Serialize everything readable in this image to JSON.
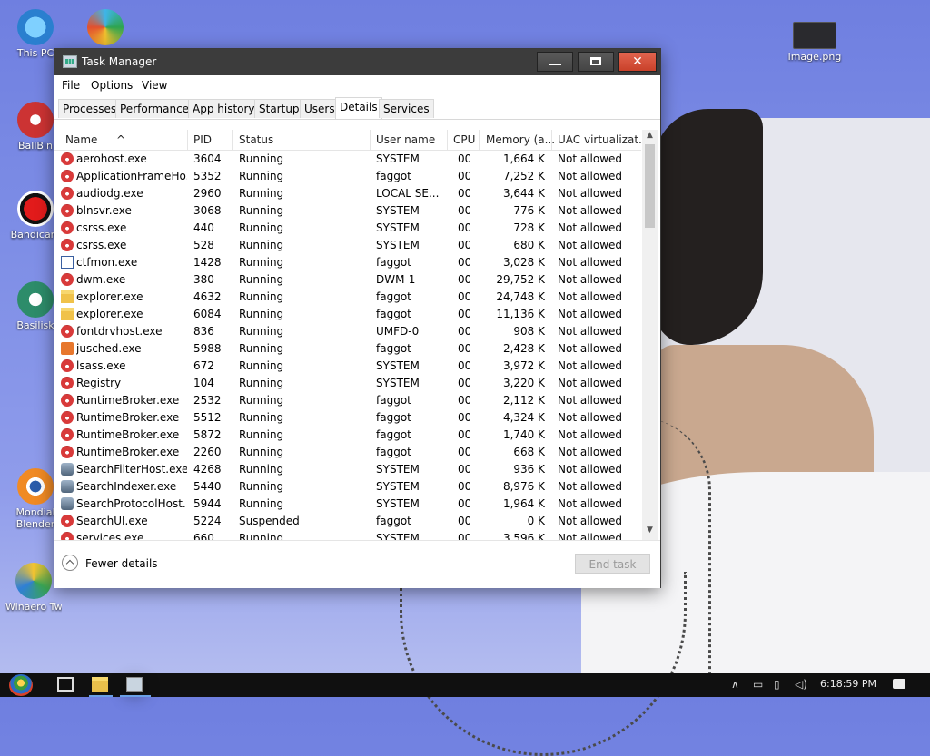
{
  "desktop": {
    "icons": [
      {
        "label": "This PC"
      },
      {
        "label": ""
      },
      {
        "label": "BallBin"
      },
      {
        "label": "Bandicam"
      },
      {
        "label": "Basilisk"
      },
      {
        "label": "Mondial Blender"
      },
      {
        "label": "Winaero Tw..."
      },
      {
        "label": "image.png"
      }
    ]
  },
  "window": {
    "title": "Task Manager",
    "menu": [
      "File",
      "Options",
      "View"
    ],
    "tabs": [
      "Processes",
      "Performance",
      "App history",
      "Startup",
      "Users",
      "Details",
      "Services"
    ],
    "active_tab": "Details",
    "columns": [
      "Name",
      "PID",
      "Status",
      "User name",
      "CPU",
      "Memory (a...",
      "UAC virtualizat..."
    ],
    "rows": [
      {
        "name": "aerohost.exe",
        "pid": "3604",
        "status": "Running",
        "user": "SYSTEM",
        "cpu": "00",
        "mem": "1,664 K",
        "uac": "Not allowed",
        "icon": "generic-process-icon"
      },
      {
        "name": "ApplicationFrameHo...",
        "pid": "5352",
        "status": "Running",
        "user": "faggot",
        "cpu": "00",
        "mem": "7,252 K",
        "uac": "Not allowed",
        "icon": "generic-process-icon"
      },
      {
        "name": "audiodg.exe",
        "pid": "2960",
        "status": "Running",
        "user": "LOCAL SE...",
        "cpu": "00",
        "mem": "3,644 K",
        "uac": "Not allowed",
        "icon": "generic-process-icon"
      },
      {
        "name": "blnsvr.exe",
        "pid": "3068",
        "status": "Running",
        "user": "SYSTEM",
        "cpu": "00",
        "mem": "776 K",
        "uac": "Not allowed",
        "icon": "generic-process-icon"
      },
      {
        "name": "csrss.exe",
        "pid": "440",
        "status": "Running",
        "user": "SYSTEM",
        "cpu": "00",
        "mem": "728 K",
        "uac": "Not allowed",
        "icon": "generic-process-icon"
      },
      {
        "name": "csrss.exe",
        "pid": "528",
        "status": "Running",
        "user": "SYSTEM",
        "cpu": "00",
        "mem": "680 K",
        "uac": "Not allowed",
        "icon": "generic-process-icon"
      },
      {
        "name": "ctfmon.exe",
        "pid": "1428",
        "status": "Running",
        "user": "faggot",
        "cpu": "00",
        "mem": "3,028 K",
        "uac": "Not allowed",
        "icon": "ctfmon-icon"
      },
      {
        "name": "dwm.exe",
        "pid": "380",
        "status": "Running",
        "user": "DWM-1",
        "cpu": "00",
        "mem": "29,752 K",
        "uac": "Not allowed",
        "icon": "generic-process-icon"
      },
      {
        "name": "explorer.exe",
        "pid": "4632",
        "status": "Running",
        "user": "faggot",
        "cpu": "00",
        "mem": "24,748 K",
        "uac": "Not allowed",
        "icon": "folder-icon"
      },
      {
        "name": "explorer.exe",
        "pid": "6084",
        "status": "Running",
        "user": "faggot",
        "cpu": "00",
        "mem": "11,136 K",
        "uac": "Not allowed",
        "icon": "folder-icon"
      },
      {
        "name": "fontdrvhost.exe",
        "pid": "836",
        "status": "Running",
        "user": "UMFD-0",
        "cpu": "00",
        "mem": "908 K",
        "uac": "Not allowed",
        "icon": "generic-process-icon"
      },
      {
        "name": "jusched.exe",
        "pid": "5988",
        "status": "Running",
        "user": "faggot",
        "cpu": "00",
        "mem": "2,428 K",
        "uac": "Not allowed",
        "icon": "java-icon"
      },
      {
        "name": "lsass.exe",
        "pid": "672",
        "status": "Running",
        "user": "SYSTEM",
        "cpu": "00",
        "mem": "3,972 K",
        "uac": "Not allowed",
        "icon": "generic-process-icon"
      },
      {
        "name": "Registry",
        "pid": "104",
        "status": "Running",
        "user": "SYSTEM",
        "cpu": "00",
        "mem": "3,220 K",
        "uac": "Not allowed",
        "icon": "generic-process-icon"
      },
      {
        "name": "RuntimeBroker.exe",
        "pid": "2532",
        "status": "Running",
        "user": "faggot",
        "cpu": "00",
        "mem": "2,112 K",
        "uac": "Not allowed",
        "icon": "generic-process-icon"
      },
      {
        "name": "RuntimeBroker.exe",
        "pid": "5512",
        "status": "Running",
        "user": "faggot",
        "cpu": "00",
        "mem": "4,324 K",
        "uac": "Not allowed",
        "icon": "generic-process-icon"
      },
      {
        "name": "RuntimeBroker.exe",
        "pid": "5872",
        "status": "Running",
        "user": "faggot",
        "cpu": "00",
        "mem": "1,740 K",
        "uac": "Not allowed",
        "icon": "generic-process-icon"
      },
      {
        "name": "RuntimeBroker.exe",
        "pid": "2260",
        "status": "Running",
        "user": "faggot",
        "cpu": "00",
        "mem": "668 K",
        "uac": "Not allowed",
        "icon": "generic-process-icon"
      },
      {
        "name": "SearchFilterHost.exe",
        "pid": "4268",
        "status": "Running",
        "user": "SYSTEM",
        "cpu": "00",
        "mem": "936 K",
        "uac": "Not allowed",
        "icon": "search-service-icon"
      },
      {
        "name": "SearchIndexer.exe",
        "pid": "5440",
        "status": "Running",
        "user": "SYSTEM",
        "cpu": "00",
        "mem": "8,976 K",
        "uac": "Not allowed",
        "icon": "search-service-icon"
      },
      {
        "name": "SearchProtocolHost....",
        "pid": "5944",
        "status": "Running",
        "user": "SYSTEM",
        "cpu": "00",
        "mem": "1,964 K",
        "uac": "Not allowed",
        "icon": "search-service-icon"
      },
      {
        "name": "SearchUI.exe",
        "pid": "5224",
        "status": "Suspended",
        "user": "faggot",
        "cpu": "00",
        "mem": "0 K",
        "uac": "Not allowed",
        "icon": "generic-process-icon"
      },
      {
        "name": "services.exe",
        "pid": "660",
        "status": "Running",
        "user": "SYSTEM",
        "cpu": "00",
        "mem": "3,596 K",
        "uac": "Not allowed",
        "icon": "generic-process-icon"
      }
    ],
    "footer": {
      "fewer_details": "Fewer details",
      "end_task": "End task"
    }
  },
  "taskbar": {
    "clock": "6:18:59 PM"
  },
  "colors": {
    "titlebar": "#3c3c3c",
    "close_button": "#d9533a",
    "process_icon": "#d83a3a"
  }
}
